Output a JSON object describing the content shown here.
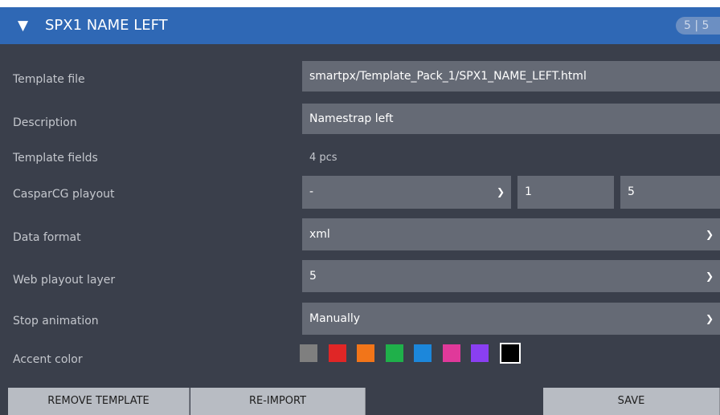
{
  "header": {
    "title": "SPX1 NAME LEFT",
    "counter": "5 | 5"
  },
  "rows": {
    "template_file": {
      "label": "Template file",
      "value": "smartpx/Template_Pack_1/SPX1_NAME_LEFT.html"
    },
    "description": {
      "label": "Description",
      "value": "Namestrap left"
    },
    "template_fields": {
      "label": "Template fields",
      "value": "4 pcs"
    },
    "casparcg": {
      "label": "CasparCG playout",
      "server": "-",
      "channel": "1",
      "layer": "5"
    },
    "data_format": {
      "label": "Data format",
      "value": "xml"
    },
    "web_layer": {
      "label": "Web playout layer",
      "value": "5"
    },
    "stop_animation": {
      "label": "Stop animation",
      "value": "Manually"
    },
    "accent_color": {
      "label": "Accent color",
      "colors": [
        "#7f7f7f",
        "#e02626",
        "#f27519",
        "#1fb04a",
        "#1c87db",
        "#e0399a",
        "#8a3ff2",
        "#000000"
      ],
      "selected_index": 7
    }
  },
  "buttons": {
    "remove": "REMOVE TEMPLATE",
    "reimport": "RE-IMPORT",
    "save": "SAVE"
  }
}
